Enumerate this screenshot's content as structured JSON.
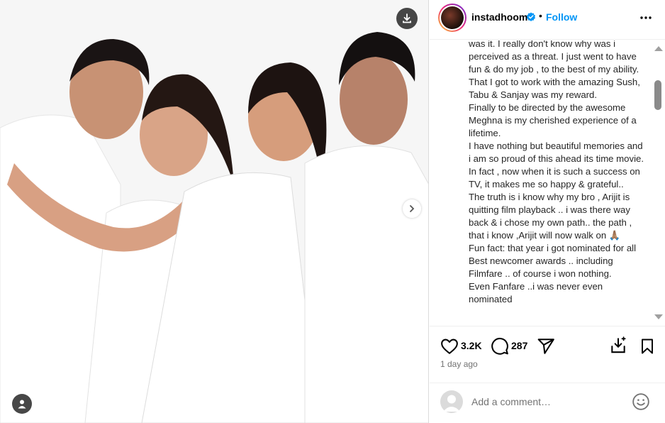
{
  "post": {
    "username": "instadhoom",
    "separator": "•",
    "follow_label": "Follow",
    "caption": "was it. I really don't know why was i perceived as a threat. I just went to have fun & do my job , to the best of my ability.\nThat I got to work with the amazing Sush, Tabu & Sanjay was my reward.\nFinally to be directed by the awesome Meghna is my cherished experience of a lifetime.\nI have nothing but beautiful memories and i am so proud of this ahead its time movie. In fact , now when it is such a success on TV, it makes me so happy & grateful..\nThe truth is i know why my bro , Arijit is quitting film playback .. i was there way back & i chose my own path.. the path , that i know ,Arijit will now walk on 🙏🏽\nFun fact: that year i got nominated for all Best newcomer awards .. including Filmfare .. of course i won nothing.\nEven Fanfare ..i was never even nominated",
    "likes": "3.2K",
    "comments": "287",
    "time_ago": "1 day ago",
    "comment_placeholder": "Add a comment…"
  },
  "media": {
    "carousel_total": 4,
    "carousel_index": 0
  },
  "icons": {
    "download": "download-icon",
    "next": "chevron-right-icon",
    "user_tag": "user-tag-icon",
    "verified": "verified-badge-icon",
    "more": "more-options-icon",
    "like": "heart-icon",
    "comment": "comment-icon",
    "share": "share-icon",
    "remix": "remix-icon",
    "save": "bookmark-icon",
    "emoji": "emoji-icon"
  },
  "colors": {
    "accent": "#0095f6",
    "verified": "#0095f6",
    "secondary_text": "#737373"
  }
}
